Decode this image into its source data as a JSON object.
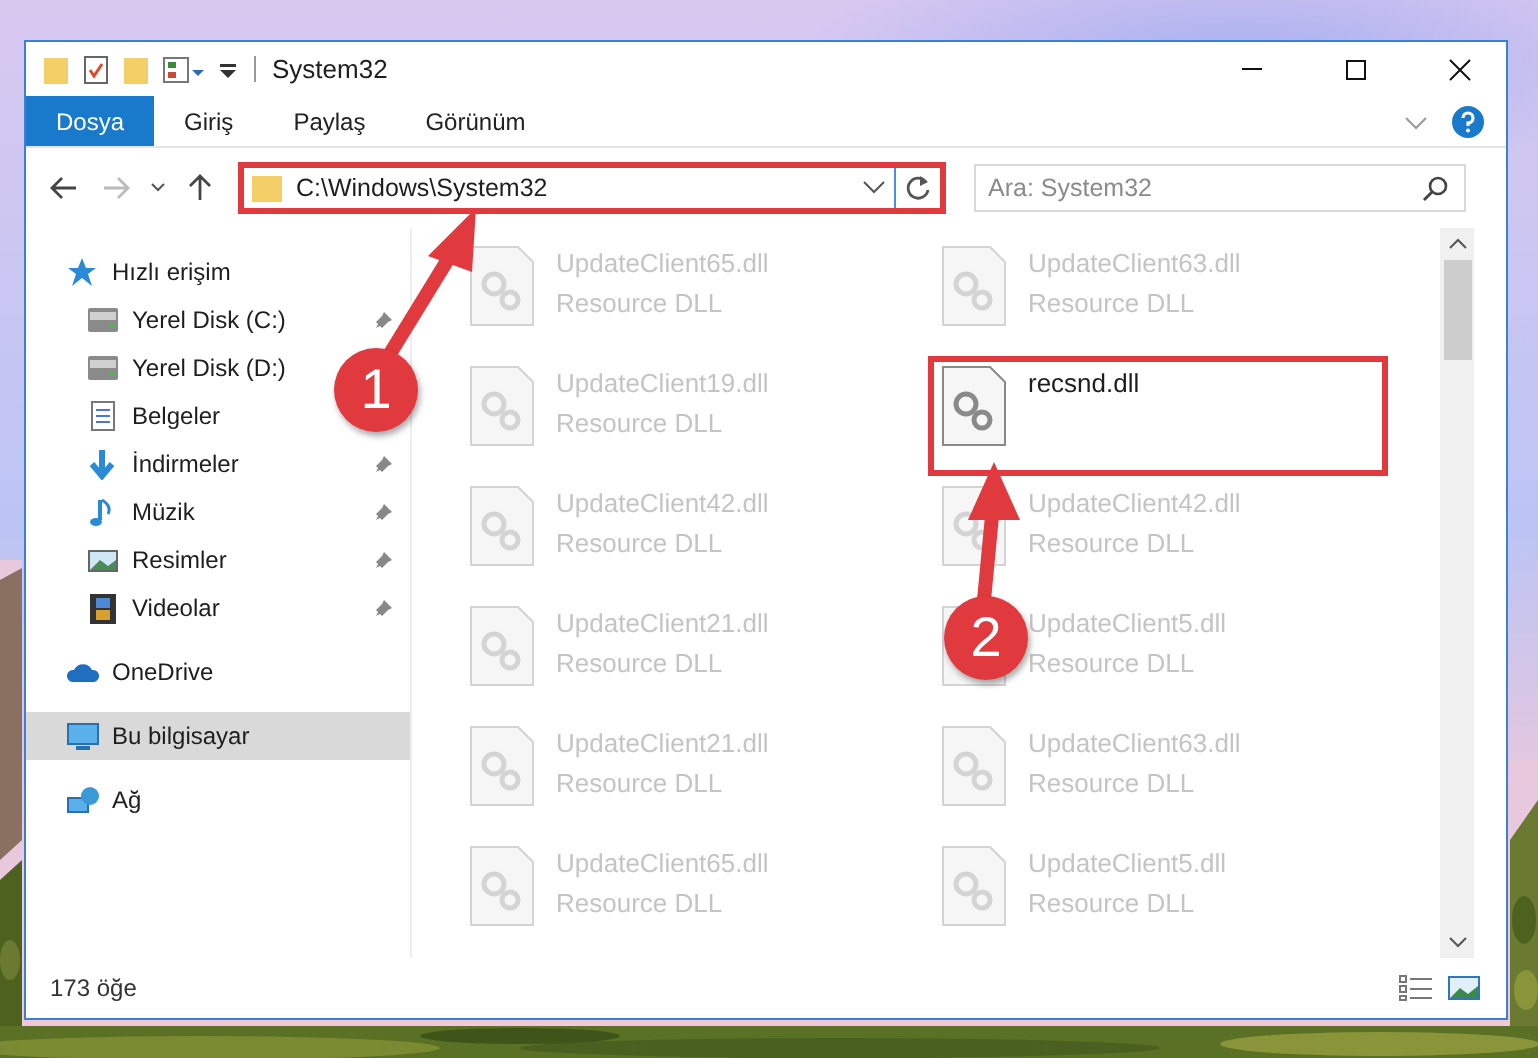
{
  "window": {
    "title": "System32"
  },
  "ribbon_tabs": [
    {
      "label": "Dosya",
      "selected": true
    },
    {
      "label": "Giriş",
      "selected": false
    },
    {
      "label": "Paylaş",
      "selected": false
    },
    {
      "label": "Görünüm",
      "selected": false
    }
  ],
  "address": {
    "path": "C:\\Windows\\System32",
    "highlighted": true
  },
  "search": {
    "placeholder": "Ara: System32"
  },
  "nav": [
    {
      "label": "Hızlı erişim",
      "kind": "quick",
      "selected": false,
      "children": [
        {
          "label": "Yerel Disk (C:)",
          "kind": "drive",
          "pinned": true,
          "selected": false
        },
        {
          "label": "Yerel Disk (D:)",
          "kind": "drive",
          "pinned": false,
          "selected": false
        },
        {
          "label": "Belgeler",
          "kind": "docs",
          "pinned": false,
          "selected": false
        },
        {
          "label": "İndirmeler",
          "kind": "download",
          "pinned": true,
          "selected": false
        },
        {
          "label": "Müzik",
          "kind": "music",
          "pinned": true,
          "selected": false
        },
        {
          "label": "Resimler",
          "kind": "pictures",
          "pinned": true,
          "selected": false
        },
        {
          "label": "Videolar",
          "kind": "videos",
          "pinned": true,
          "selected": false
        }
      ]
    },
    {
      "label": "OneDrive",
      "kind": "cloud",
      "selected": false
    },
    {
      "label": "Bu bilgisayar",
      "kind": "pc",
      "selected": true
    },
    {
      "label": "Ağ",
      "kind": "network",
      "selected": false
    }
  ],
  "files": [
    {
      "name": "UpdateClient65.dll",
      "type": "Resource DLL",
      "blurred": true,
      "highlighted": false
    },
    {
      "name": "UpdateClient63.dll",
      "type": "Resource DLL",
      "blurred": true,
      "highlighted": false
    },
    {
      "name": "UpdateClient19.dll",
      "type": "Resource DLL",
      "blurred": true,
      "highlighted": false
    },
    {
      "name": "recsnd.dll",
      "blurred": false,
      "highlighted": true
    },
    {
      "name": "UpdateClient42.dll",
      "type": "Resource DLL",
      "blurred": true,
      "highlighted": false
    },
    {
      "name": "UpdateClient42.dll",
      "type": "Resource DLL",
      "blurred": true,
      "highlighted": false
    },
    {
      "name": "UpdateClient21.dll",
      "type": "Resource DLL",
      "blurred": true,
      "highlighted": false
    },
    {
      "name": "UpdateClient5.dll",
      "type": "Resource DLL",
      "blurred": true,
      "highlighted": false
    },
    {
      "name": "UpdateClient21.dll",
      "type": "Resource DLL",
      "blurred": true,
      "highlighted": false
    },
    {
      "name": "UpdateClient63.dll",
      "type": "Resource DLL",
      "blurred": true,
      "highlighted": false
    },
    {
      "name": "UpdateClient65.dll",
      "type": "Resource DLL",
      "blurred": true,
      "highlighted": false
    },
    {
      "name": "UpdateClient5.dll",
      "type": "Resource DLL",
      "blurred": true,
      "highlighted": false
    }
  ],
  "status_bar": {
    "count": "173 öğe"
  },
  "callouts": [
    {
      "number": "1"
    },
    {
      "number": "2"
    }
  ]
}
